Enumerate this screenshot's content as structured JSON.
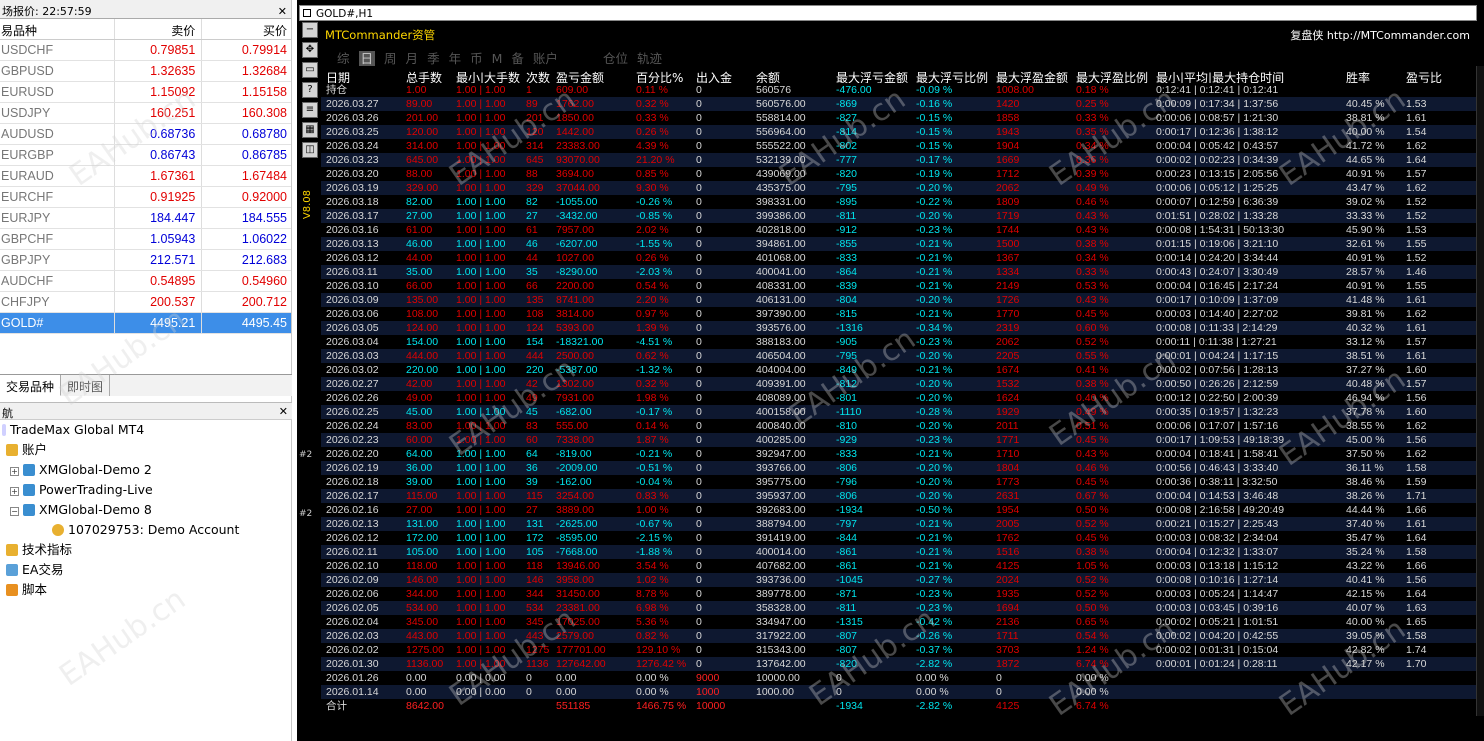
{
  "market_watch": {
    "title": "场报价: 22:57:59",
    "col_symbol": "易品种",
    "col_bid": "卖价",
    "col_ask": "买价",
    "rows": [
      {
        "symbol": "USDCHF",
        "bid": "0.79851",
        "ask": "0.79914",
        "bid_color": "red",
        "ask_color": "red"
      },
      {
        "symbol": "GBPUSD",
        "bid": "1.32635",
        "ask": "1.32684",
        "bid_color": "red",
        "ask_color": "red"
      },
      {
        "symbol": "EURUSD",
        "bid": "1.15092",
        "ask": "1.15158",
        "bid_color": "red",
        "ask_color": "red"
      },
      {
        "symbol": "USDJPY",
        "bid": "160.251",
        "ask": "160.308",
        "bid_color": "red",
        "ask_color": "red"
      },
      {
        "symbol": "AUDUSD",
        "bid": "0.68736",
        "ask": "0.68780",
        "bid_color": "blue",
        "ask_color": "blue"
      },
      {
        "symbol": "EURGBP",
        "bid": "0.86743",
        "ask": "0.86785",
        "bid_color": "blue",
        "ask_color": "blue"
      },
      {
        "symbol": "EURAUD",
        "bid": "1.67361",
        "ask": "1.67484",
        "bid_color": "red",
        "ask_color": "red"
      },
      {
        "symbol": "EURCHF",
        "bid": "0.91925",
        "ask": "0.92000",
        "bid_color": "red",
        "ask_color": "red"
      },
      {
        "symbol": "EURJPY",
        "bid": "184.447",
        "ask": "184.555",
        "bid_color": "blue",
        "ask_color": "blue"
      },
      {
        "symbol": "GBPCHF",
        "bid": "1.05943",
        "ask": "1.06022",
        "bid_color": "blue",
        "ask_color": "blue"
      },
      {
        "symbol": "GBPJPY",
        "bid": "212.571",
        "ask": "212.683",
        "bid_color": "blue",
        "ask_color": "blue"
      },
      {
        "symbol": "AUDCHF",
        "bid": "0.54895",
        "ask": "0.54960",
        "bid_color": "red",
        "ask_color": "red"
      },
      {
        "symbol": "CHFJPY",
        "bid": "200.537",
        "ask": "200.712",
        "bid_color": "red",
        "ask_color": "red"
      },
      {
        "symbol": "GOLD#",
        "bid": "4495.21",
        "ask": "4495.45",
        "bid_color": "sel",
        "ask_color": "sel"
      }
    ],
    "tabs": [
      "交易品种",
      "即时图"
    ]
  },
  "navigator": {
    "title": "航",
    "root": "TradeMax Global MT4",
    "accounts_label": "账户",
    "servers": [
      "XMGlobal-Demo 2",
      "PowerTrading-Live",
      "XMGlobal-Demo 8"
    ],
    "account": "107029753: Demo Account",
    "indicators": "技术指标",
    "experts": "EA交易",
    "scripts": "脚本"
  },
  "chart": {
    "window_title": "GOLD#,H1",
    "version_label": "V8.08",
    "side_marks": [
      "#2",
      "#2"
    ]
  },
  "panel": {
    "brand": "MTCommander资管",
    "brand_right_label": "复盘侠",
    "brand_right_url": "http://MTCommander.com",
    "tabs": [
      "综",
      "日",
      "周",
      "月",
      "季",
      "年",
      "币",
      "M",
      "备",
      "账户",
      "",
      "仓位",
      "轨迹"
    ],
    "active_tab": "日",
    "headers": [
      "日期",
      "总手数",
      "最小|大手数",
      "次数",
      "盈亏金额",
      "百分比%",
      "出入金",
      "余额",
      "最大浮亏金额",
      "最大浮亏比例",
      "最大浮盈金额",
      "最大浮盈比例",
      "最小|平均|最大持仓时间",
      "胜率",
      "盈亏比"
    ],
    "rows": [
      [
        "持仓",
        "1.00",
        "1.00 | 1.00",
        "1",
        "609.00",
        "0.11 %",
        "0",
        "560576",
        "-476.00",
        "-0.09 %",
        "1008.00",
        "0.18 %",
        "0:12:41 | 0:12:41 | 0:12:41",
        "",
        ""
      ],
      [
        "2026.03.27",
        "89.00",
        "1.00 | 1.00",
        "89",
        "1762.00",
        "0.32 %",
        "0",
        "560576.00",
        "-869",
        "-0.16 %",
        "1420",
        "0.25 %",
        "0:00:09 | 0:17:34 | 1:37:56",
        "40.45 %",
        "1.53"
      ],
      [
        "2026.03.26",
        "201.00",
        "1.00 | 1.00",
        "201",
        "1850.00",
        "0.33 %",
        "0",
        "558814.00",
        "-827",
        "-0.15 %",
        "1858",
        "0.33 %",
        "0:00:06 | 0:08:57 | 1:21:30",
        "38.81 %",
        "1.61"
      ],
      [
        "2026.03.25",
        "120.00",
        "1.00 | 1.00",
        "120",
        "1442.00",
        "0.26 %",
        "0",
        "556964.00",
        "-814",
        "-0.15 %",
        "1943",
        "0.35 %",
        "0:00:17 | 0:12:36 | 1:38:12",
        "40.00 %",
        "1.54"
      ],
      [
        "2026.03.24",
        "314.00",
        "1.00 | 1.00",
        "314",
        "23383.00",
        "4.39 %",
        "0",
        "555522.00",
        "-802",
        "-0.15 %",
        "1904",
        "0.34 %",
        "0:00:04 | 0:05:42 | 0:43:57",
        "41.72 %",
        "1.62"
      ],
      [
        "2026.03.23",
        "645.00",
        "1.00 | 1.00",
        "645",
        "93070.00",
        "21.20 %",
        "0",
        "532139.00",
        "-777",
        "-0.17 %",
        "1669",
        "0.36 %",
        "0:00:02 | 0:02:23 | 0:34:39",
        "44.65 %",
        "1.64"
      ],
      [
        "2026.03.20",
        "88.00",
        "1.00 | 1.00",
        "88",
        "3694.00",
        "0.85 %",
        "0",
        "439069.00",
        "-820",
        "-0.19 %",
        "1712",
        "0.39 %",
        "0:00:23 | 0:13:15 | 2:05:56",
        "40.91 %",
        "1.57"
      ],
      [
        "2026.03.19",
        "329.00",
        "1.00 | 1.00",
        "329",
        "37044.00",
        "9.30 %",
        "0",
        "435375.00",
        "-795",
        "-0.20 %",
        "2062",
        "0.49 %",
        "0:00:06 | 0:05:12 | 1:25:25",
        "43.47 %",
        "1.62"
      ],
      [
        "2026.03.18",
        "82.00",
        "1.00 | 1.00",
        "82",
        "-1055.00",
        "-0.26 %",
        "0",
        "398331.00",
        "-895",
        "-0.22 %",
        "1809",
        "0.46 %",
        "0:00:07 | 0:12:59 | 6:36:39",
        "39.02 %",
        "1.52"
      ],
      [
        "2026.03.17",
        "27.00",
        "1.00 | 1.00",
        "27",
        "-3432.00",
        "-0.85 %",
        "0",
        "399386.00",
        "-811",
        "-0.20 %",
        "1719",
        "0.43 %",
        "0:01:51 | 0:28:02 | 1:33:28",
        "33.33 %",
        "1.52"
      ],
      [
        "2026.03.16",
        "61.00",
        "1.00 | 1.00",
        "61",
        "7957.00",
        "2.02 %",
        "0",
        "402818.00",
        "-912",
        "-0.23 %",
        "1744",
        "0.43 %",
        "0:00:08 | 1:54:31 | 50:13:30",
        "45.90 %",
        "1.53"
      ],
      [
        "2026.03.13",
        "46.00",
        "1.00 | 1.00",
        "46",
        "-6207.00",
        "-1.55 %",
        "0",
        "394861.00",
        "-855",
        "-0.21 %",
        "1500",
        "0.38 %",
        "0:01:15 | 0:19:06 | 3:21:10",
        "32.61 %",
        "1.55"
      ],
      [
        "2026.03.12",
        "44.00",
        "1.00 | 1.00",
        "44",
        "1027.00",
        "0.26 %",
        "0",
        "401068.00",
        "-833",
        "-0.21 %",
        "1367",
        "0.34 %",
        "0:00:14 | 0:24:20 | 3:34:44",
        "40.91 %",
        "1.52"
      ],
      [
        "2026.03.11",
        "35.00",
        "1.00 | 1.00",
        "35",
        "-8290.00",
        "-2.03 %",
        "0",
        "400041.00",
        "-864",
        "-0.21 %",
        "1334",
        "0.33 %",
        "0:00:43 | 0:24:07 | 3:30:49",
        "28.57 %",
        "1.46"
      ],
      [
        "2026.03.10",
        "66.00",
        "1.00 | 1.00",
        "66",
        "2200.00",
        "0.54 %",
        "0",
        "408331.00",
        "-839",
        "-0.21 %",
        "2149",
        "0.53 %",
        "0:00:04 | 0:16:45 | 2:17:24",
        "40.91 %",
        "1.55"
      ],
      [
        "2026.03.09",
        "135.00",
        "1.00 | 1.00",
        "135",
        "8741.00",
        "2.20 %",
        "0",
        "406131.00",
        "-804",
        "-0.20 %",
        "1726",
        "0.43 %",
        "0:00:17 | 0:10:09 | 1:37:09",
        "41.48 %",
        "1.61"
      ],
      [
        "2026.03.06",
        "108.00",
        "1.00 | 1.00",
        "108",
        "3814.00",
        "0.97 %",
        "0",
        "397390.00",
        "-815",
        "-0.21 %",
        "1770",
        "0.45 %",
        "0:00:03 | 0:14:40 | 2:27:02",
        "39.81 %",
        "1.62"
      ],
      [
        "2026.03.05",
        "124.00",
        "1.00 | 1.00",
        "124",
        "5393.00",
        "1.39 %",
        "0",
        "393576.00",
        "-1316",
        "-0.34 %",
        "2319",
        "0.60 %",
        "0:00:08 | 0:11:33 | 2:14:29",
        "40.32 %",
        "1.61"
      ],
      [
        "2026.03.04",
        "154.00",
        "1.00 | 1.00",
        "154",
        "-18321.00",
        "-4.51 %",
        "0",
        "388183.00",
        "-905",
        "-0.23 %",
        "2062",
        "0.52 %",
        "0:00:11 | 0:11:38 | 1:27:21",
        "33.12 %",
        "1.57"
      ],
      [
        "2026.03.03",
        "444.00",
        "1.00 | 1.00",
        "444",
        "2500.00",
        "0.62 %",
        "0",
        "406504.00",
        "-795",
        "-0.20 %",
        "2205",
        "0.55 %",
        "0:00:01 | 0:04:24 | 1:17:15",
        "38.51 %",
        "1.61"
      ],
      [
        "2026.03.02",
        "220.00",
        "1.00 | 1.00",
        "220",
        "-5387.00",
        "-1.32 %",
        "0",
        "404004.00",
        "-849",
        "-0.21 %",
        "1674",
        "0.41 %",
        "0:00:02 | 0:07:56 | 1:28:13",
        "37.27 %",
        "1.60"
      ],
      [
        "2026.02.27",
        "42.00",
        "1.00 | 1.00",
        "42",
        "1302.00",
        "0.32 %",
        "0",
        "409391.00",
        "-812",
        "-0.20 %",
        "1532",
        "0.38 %",
        "0:00:50 | 0:26:26 | 2:12:59",
        "40.48 %",
        "1.57"
      ],
      [
        "2026.02.26",
        "49.00",
        "1.00 | 1.00",
        "49",
        "7931.00",
        "1.98 %",
        "0",
        "408089.00",
        "-801",
        "-0.20 %",
        "1624",
        "0.40 %",
        "0:00:12 | 0:22:50 | 2:00:39",
        "46.94 %",
        "1.56"
      ],
      [
        "2026.02.25",
        "45.00",
        "1.00 | 1.00",
        "45",
        "-682.00",
        "-0.17 %",
        "0",
        "400158.00",
        "-1110",
        "-0.28 %",
        "1929",
        "0.49 %",
        "0:00:35 | 0:19:57 | 1:32:23",
        "37.78 %",
        "1.60"
      ],
      [
        "2026.02.24",
        "83.00",
        "1.00 | 1.00",
        "83",
        "555.00",
        "0.14 %",
        "0",
        "400840.00",
        "-810",
        "-0.20 %",
        "2011",
        "0.51 %",
        "0:00:06 | 0:17:07 | 1:57:16",
        "38.55 %",
        "1.62"
      ],
      [
        "2026.02.23",
        "60.00",
        "1.00 | 1.00",
        "60",
        "7338.00",
        "1.87 %",
        "0",
        "400285.00",
        "-929",
        "-0.23 %",
        "1771",
        "0.45 %",
        "0:00:17 | 1:09:53 | 49:18:39",
        "45.00 %",
        "1.56"
      ],
      [
        "2026.02.20",
        "64.00",
        "1.00 | 1.00",
        "64",
        "-819.00",
        "-0.21 %",
        "0",
        "392947.00",
        "-833",
        "-0.21 %",
        "1710",
        "0.43 %",
        "0:00:04 | 0:18:41 | 1:58:41",
        "37.50 %",
        "1.62"
      ],
      [
        "2026.02.19",
        "36.00",
        "1.00 | 1.00",
        "36",
        "-2009.00",
        "-0.51 %",
        "0",
        "393766.00",
        "-806",
        "-0.20 %",
        "1804",
        "0.46 %",
        "0:00:56 | 0:46:43 | 3:33:40",
        "36.11 %",
        "1.58"
      ],
      [
        "2026.02.18",
        "39.00",
        "1.00 | 1.00",
        "39",
        "-162.00",
        "-0.04 %",
        "0",
        "395775.00",
        "-796",
        "-0.20 %",
        "1773",
        "0.45 %",
        "0:00:36 | 0:38:11 | 3:32:50",
        "38.46 %",
        "1.59"
      ],
      [
        "2026.02.17",
        "115.00",
        "1.00 | 1.00",
        "115",
        "3254.00",
        "0.83 %",
        "0",
        "395937.00",
        "-806",
        "-0.20 %",
        "2631",
        "0.67 %",
        "0:00:04 | 0:14:53 | 3:46:48",
        "38.26 %",
        "1.71"
      ],
      [
        "2026.02.16",
        "27.00",
        "1.00 | 1.00",
        "27",
        "3889.00",
        "1.00 %",
        "0",
        "392683.00",
        "-1934",
        "-0.50 %",
        "1954",
        "0.50 %",
        "0:00:08 | 2:16:58 | 49:20:49",
        "44.44 %",
        "1.66"
      ],
      [
        "2026.02.13",
        "131.00",
        "1.00 | 1.00",
        "131",
        "-2625.00",
        "-0.67 %",
        "0",
        "388794.00",
        "-797",
        "-0.21 %",
        "2005",
        "0.52 %",
        "0:00:21 | 0:15:27 | 2:25:43",
        "37.40 %",
        "1.61"
      ],
      [
        "2026.02.12",
        "172.00",
        "1.00 | 1.00",
        "172",
        "-8595.00",
        "-2.15 %",
        "0",
        "391419.00",
        "-844",
        "-0.21 %",
        "1762",
        "0.45 %",
        "0:00:03 | 0:08:32 | 2:34:04",
        "35.47 %",
        "1.64"
      ],
      [
        "2026.02.11",
        "105.00",
        "1.00 | 1.00",
        "105",
        "-7668.00",
        "-1.88 %",
        "0",
        "400014.00",
        "-861",
        "-0.21 %",
        "1516",
        "0.38 %",
        "0:00:04 | 0:12:32 | 1:33:07",
        "35.24 %",
        "1.58"
      ],
      [
        "2026.02.10",
        "118.00",
        "1.00 | 1.00",
        "118",
        "13946.00",
        "3.54 %",
        "0",
        "407682.00",
        "-861",
        "-0.21 %",
        "4125",
        "1.05 %",
        "0:00:03 | 0:13:18 | 1:15:12",
        "43.22 %",
        "1.66"
      ],
      [
        "2026.02.09",
        "146.00",
        "1.00 | 1.00",
        "146",
        "3958.00",
        "1.02 %",
        "0",
        "393736.00",
        "-1045",
        "-0.27 %",
        "2024",
        "0.52 %",
        "0:00:08 | 0:10:16 | 1:27:14",
        "40.41 %",
        "1.56"
      ],
      [
        "2026.02.06",
        "344.00",
        "1.00 | 1.00",
        "344",
        "31450.00",
        "8.78 %",
        "0",
        "389778.00",
        "-871",
        "-0.23 %",
        "1935",
        "0.52 %",
        "0:00:03 | 0:05:24 | 1:14:47",
        "42.15 %",
        "1.64"
      ],
      [
        "2026.02.05",
        "534.00",
        "1.00 | 1.00",
        "534",
        "23381.00",
        "6.98 %",
        "0",
        "358328.00",
        "-811",
        "-0.23 %",
        "1694",
        "0.50 %",
        "0:00:03 | 0:03:45 | 0:39:16",
        "40.07 %",
        "1.63"
      ],
      [
        "2026.02.04",
        "345.00",
        "1.00 | 1.00",
        "345",
        "17025.00",
        "5.36 %",
        "0",
        "334947.00",
        "-1315",
        "-0.42 %",
        "2136",
        "0.65 %",
        "0:00:02 | 0:05:21 | 1:01:51",
        "40.00 %",
        "1.65"
      ],
      [
        "2026.02.03",
        "443.00",
        "1.00 | 1.00",
        "443",
        "2579.00",
        "0.82 %",
        "0",
        "317922.00",
        "-807",
        "-0.26 %",
        "1711",
        "0.54 %",
        "0:00:02 | 0:04:20 | 0:42:55",
        "39.05 %",
        "1.58"
      ],
      [
        "2026.02.02",
        "1275.00",
        "1.00 | 1.00",
        "1275",
        "177701.00",
        "129.10 %",
        "0",
        "315343.00",
        "-807",
        "-0.37 %",
        "3703",
        "1.24 %",
        "0:00:02 | 0:01:31 | 0:15:04",
        "42.82 %",
        "1.74"
      ],
      [
        "2026.01.30",
        "1136.00",
        "1.00 | 1.00",
        "1136",
        "127642.00",
        "1276.42 %",
        "0",
        "137642.00",
        "-820",
        "-2.82 %",
        "1872",
        "6.74 %",
        "0:00:01 | 0:01:24 | 0:28:11",
        "42.17 %",
        "1.70"
      ],
      [
        "2026.01.26",
        "0.00",
        "0.00 | 0.00",
        "0",
        "0.00",
        "0.00 %",
        "9000",
        "10000.00",
        "0",
        "0.00 %",
        "0",
        "0.00 %",
        "",
        "",
        ""
      ],
      [
        "2026.01.14",
        "0.00",
        "0.00 | 0.00",
        "0",
        "0.00",
        "0.00 %",
        "1000",
        "1000.00",
        "0",
        "0.00 %",
        "0",
        "0.00 %",
        "",
        "",
        ""
      ],
      [
        "合计",
        "8642.00",
        "",
        "",
        "551185",
        "1466.75 %",
        "10000",
        "",
        "-1934",
        "-2.82 %",
        "4125",
        "6.74 %",
        "",
        "",
        ""
      ]
    ]
  },
  "watermark": "EAHub.cn"
}
